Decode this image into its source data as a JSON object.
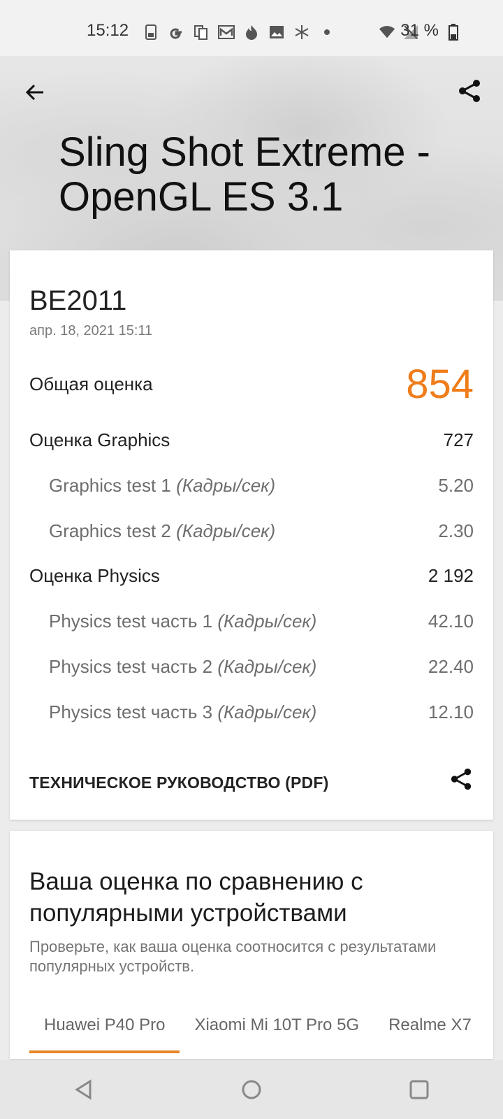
{
  "status_bar": {
    "time": "15:12",
    "battery": "31 %",
    "icons": [
      "sim-icon",
      "google-icon",
      "copy-icon",
      "mail-icon",
      "fire-icon",
      "image-icon",
      "snowflake-icon",
      "dot-icon",
      "wifi-icon",
      "no-signal-icon",
      "battery-icon"
    ]
  },
  "header": {
    "title": "Sling Shot Extreme - OpenGL ES 3.1"
  },
  "result": {
    "device": "BE2011",
    "date": "апр. 18, 2021 15:11",
    "total_label": "Общая оценка",
    "total_value": "854",
    "graphics_label": "Оценка Graphics",
    "graphics_value": "727",
    "gt1_label": "Graphics test 1",
    "gt1_unit": "(Кадры/сек)",
    "gt1_value": "5.20",
    "gt2_label": "Graphics test 2",
    "gt2_unit": "(Кадры/сек)",
    "gt2_value": "2.30",
    "physics_label": "Оценка Physics",
    "physics_value": "2 192",
    "pt1_label": "Physics test часть 1",
    "pt1_unit": "(Кадры/сек)",
    "pt1_value": "42.10",
    "pt2_label": "Physics test часть 2",
    "pt2_unit": "(Кадры/сек)",
    "pt2_value": "22.40",
    "pt3_label": "Physics test часть 3",
    "pt3_unit": "(Кадры/сек)",
    "pt3_value": "12.10",
    "pdf_label": "ТЕХНИЧЕСКОЕ РУКОВОДСТВО (PDF)"
  },
  "comparison": {
    "title": "Ваша оценка по сравнению с популярными устройствами",
    "subtitle": "Проверьте, как ваша оценка соотносится с результатами популярных устройств.",
    "tabs": [
      "Huawei P40 Pro",
      "Xiaomi Mi 10T Pro 5G",
      "Realme X7"
    ]
  },
  "colors": {
    "accent": "#f07d1a",
    "tab_indicator": "#e8862a"
  }
}
